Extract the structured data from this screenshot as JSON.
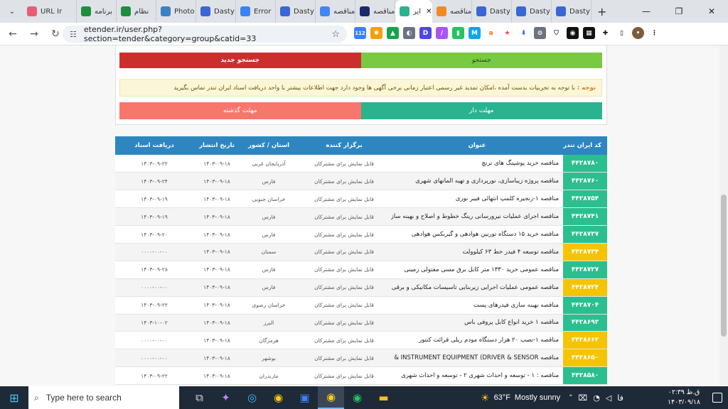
{
  "browser": {
    "tabs": [
      {
        "label": "URL Ir",
        "icon": "link-icon",
        "color": "#e85d75"
      },
      {
        "label": "برنامه",
        "icon": "sheets-icon",
        "color": "#1e8e3e"
      },
      {
        "label": "نظام",
        "icon": "sheets-icon",
        "color": "#1e8e3e"
      },
      {
        "label": "Photo",
        "icon": "photo-icon",
        "color": "#3b82c4"
      },
      {
        "label": "Dasty",
        "icon": "dasty-icon",
        "color": "#3a66d6"
      },
      {
        "label": "Error",
        "icon": "star-icon",
        "color": "#3b82f6"
      },
      {
        "label": "Dasty",
        "icon": "dasty-icon",
        "color": "#3a66d6"
      },
      {
        "label": "مناقصه",
        "icon": "google-icon",
        "color": "#4285f4"
      },
      {
        "label": "مناقصه",
        "icon": "building-icon",
        "color": "#1b2a6b"
      },
      {
        "label": "ایر",
        "icon": "etender-icon",
        "color": "#29b38f",
        "active": true
      },
      {
        "label": "مناقصه",
        "icon": "sun-icon",
        "color": "#f08a24"
      },
      {
        "label": "Dasty",
        "icon": "dasty-icon",
        "color": "#3a66d6"
      },
      {
        "label": "Dasty",
        "icon": "dasty-icon",
        "color": "#3a66d6"
      },
      {
        "label": "Dasty",
        "icon": "dasty-icon",
        "color": "#3a66d6"
      }
    ],
    "url": "etender.ir/user.php?section=tender&category=group&catid=33",
    "ext_badge": "112"
  },
  "search": {
    "search_label": "جستجو",
    "new_search_label": "جستجو جدید"
  },
  "notice": {
    "prefix": "توجه :",
    "text": "با توجه به تجربیات بدست آمده ،امکان تمدید غیر رسمی اعتبار زمانی برخی آگهی ها وجود دارد جهت اطلاعات بیشتر با واحد دریافت اسناد ایران تندر تماس بگیرید"
  },
  "filters": {
    "active_label": "مهلت دار",
    "expired_label": "مهلت گذشته"
  },
  "table": {
    "headers": [
      "کد ایران تندر",
      "عنوان",
      "برگزار کننده",
      "استان / کشور",
      "تاریخ انتشار",
      "دریافت اسناد"
    ],
    "rows": [
      {
        "code": "۴۴۲۸۷۸۰",
        "status": "green",
        "title": "مناقصه خرید پوشینگ های ترنچ",
        "organizer": "قابل نمایش برای مشترکان",
        "province": "آذربایجان غربی",
        "published": "۱۴۰۳-۰۹-۱۸",
        "deadline": "۱۴۰۳-۰۹-۲۲"
      },
      {
        "code": "۴۴۲۸۷۶۰",
        "status": "green",
        "title": "مناقصه پروژه زیباسازی، نورپردازی و تهیه المانهای شهری",
        "organizer": "قابل نمایش برای مشترکان",
        "province": "فارس",
        "published": "۱۴۰۳-۰۹-۱۸",
        "deadline": "۱۴۰۳-۰۹-۲۴"
      },
      {
        "code": "۴۴۲۸۷۵۴",
        "status": "green",
        "title": "مناقصه ۱-زنجیره کلمپ انتهائی فیبر نوری",
        "organizer": "قابل نمایش برای مشترکان",
        "province": "خراسان جنوبی",
        "published": "۱۴۰۳-۰۹-۱۸",
        "deadline": "۱۴۰۳-۰۹-۱۹"
      },
      {
        "code": "۴۴۲۸۷۴۱",
        "status": "green",
        "title": "مناقصه اجرای عملیات نیرورسانی رینگ خطوط و اصلاح و بهینه سازی",
        "organizer": "قابل نمایش برای مشترکان",
        "province": "فارس",
        "published": "۱۴۰۳-۰۹-۱۸",
        "deadline": "۱۴۰۳-۰۹-۱۹"
      },
      {
        "code": "۴۴۲۸۷۳۷",
        "status": "green",
        "title": "مناقصه خرید ۱۵ دستگاه توربین هوادهی و گیربکس هوادهی",
        "organizer": "قابل نمایش برای مشترکان",
        "province": "فارس",
        "published": "۱۴۰۳-۰۹-۱۸",
        "deadline": "۱۴۰۳-۰۹-۲۰"
      },
      {
        "code": "۴۴۲۸۷۳۴",
        "status": "yellow",
        "title": "مناقصه توسعه ۴ فیدر خط ۶۳ کیلوولت",
        "organizer": "قابل نمایش برای مشترکان",
        "province": "سمنان",
        "published": "۱۴۰۳-۰۹-۱۸",
        "deadline": "۰۰۰۰-۰۰-۰۰"
      },
      {
        "code": "۴۴۲۸۷۲۷",
        "status": "green",
        "title": "مناقصه عمومی خرید ۱۳۳۰ متر کابل برق مسی مفتولی زمینی",
        "organizer": "قابل نمایش برای مشترکان",
        "province": "فارس",
        "published": "۱۴۰۳-۰۹-۱۸",
        "deadline": "۱۴۰۳-۰۹-۲۸"
      },
      {
        "code": "۴۴۲۸۷۲۴",
        "status": "yellow",
        "title": "مناقصه عمومی عملیات اجرایی زیربنایی تاسیسات مکانیکی و برقی",
        "organizer": "قابل نمایش برای مشترکان",
        "province": "فارس",
        "published": "۱۴۰۳-۰۹-۱۸",
        "deadline": "۰۰۰۰-۰۰-۰۰"
      },
      {
        "code": "۴۴۲۸۷۰۴",
        "status": "green",
        "title": "مناقصه بهینه سازی فیدرهای پست",
        "organizer": "قابل نمایش برای مشترکان",
        "province": "خراسان رضوی",
        "published": "۱۴۰۳-۰۹-۱۸",
        "deadline": "۱۴۰۳-۰۹-۲۲"
      },
      {
        "code": "۴۴۲۸۶۹۲",
        "status": "green",
        "title": "مناقصه ۱ خرید انواع کابل پروفی باس",
        "organizer": "قابل نمایش برای مشترکان",
        "province": "البرز",
        "published": "۱۴۰۳-۰۹-۱۸",
        "deadline": "۱۴۰۳-۱۰-۰۲"
      },
      {
        "code": "۴۴۲۸۶۶۲",
        "status": "yellow",
        "title": "مناقصه ۱-نصب ۲۰ هزار دستگاه مودم ریلی قرائت کنتور",
        "organizer": "قابل نمایش برای مشترکان",
        "province": "هرمزگان",
        "published": "۱۴۰۳-۰۹-۱۸",
        "deadline": "۰۰۰۰-۰۰-۰۰"
      },
      {
        "code": "۴۴۲۸۶۵۰",
        "status": "yellow",
        "title": "مناقصه INSTRUMENT EQUIPMENT (DRIVER & SENSOR &",
        "organizer": "قابل نمایش برای مشترکان",
        "province": "بوشهر",
        "published": "۱۴۰۳-۰۹-۱۸",
        "deadline": "۰۰۰۰-۰۰-۰۰"
      },
      {
        "code": "۴۴۲۸۵۸۰",
        "status": "green",
        "title": "مناقصه : ۱ - توسعه و احداث شهری ۲ - توسعه و احداث شهری",
        "organizer": "قابل نمایش برای مشترکان",
        "province": "مازندران",
        "published": "۱۴۰۳-۰۹-۱۸",
        "deadline": "۱۴۰۳-۰۹-۲۲"
      }
    ]
  },
  "taskbar": {
    "search_placeholder": "Type here to search",
    "weather_temp": "63°F",
    "weather_text": "Mostly sunny",
    "lang": "فا",
    "time": "۰۲:۳۹ ق.ظ",
    "date": "۱۴۰۳/۰۹/۱۸"
  },
  "colors": {
    "accent_green": "#29b38f",
    "accent_yellow": "#f5c400",
    "header_blue": "#2e86c1"
  }
}
